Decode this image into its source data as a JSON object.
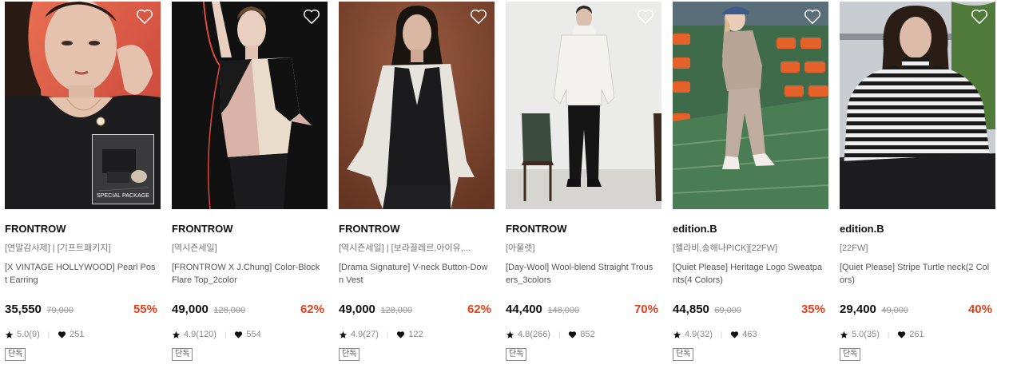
{
  "products": [
    {
      "brand": "FRONTROW",
      "tags": "[연말감사제] | [기프트패키지]",
      "name": "[X VINTAGE HOLLYWOOD] Pearl Post Earring",
      "sale_price": "35,550",
      "original_price": "79,000",
      "discount": "55%",
      "rating": "5.0(9)",
      "likes": "251",
      "badge": "단독",
      "package_label": "SPECIAL PACKAGE",
      "colors": {
        "bg": "#e06548",
        "bg2": "#c8463a",
        "top": "#1d1d1f",
        "skin": "#e4c2ae",
        "hair": "#2a1a14"
      }
    },
    {
      "brand": "FRONTROW",
      "tags": "[역시즌세일]",
      "name": "[FRONTROW X J.Chung] Color-Block Flare Top_2color",
      "sale_price": "49,000",
      "original_price": "128,000",
      "discount": "62%",
      "rating": "4.9(120)",
      "likes": "554",
      "badge": "단독",
      "colors": {
        "bg": "#0f0f10",
        "bg2": "#1a1a1b",
        "top": "#d9b3a7",
        "top2": "#e9dccb",
        "skin": "#e8cfbf",
        "hair": "#6b4a32"
      }
    },
    {
      "brand": "FRONTROW",
      "tags": "[역시즌세일] | [보라끌레르,아이유,...",
      "name": "[Drama Signature] V-neck Button-Down Vest",
      "sale_price": "49,000",
      "original_price": "128,000",
      "discount": "62%",
      "rating": "4.9(27)",
      "likes": "122",
      "badge": "단독",
      "colors": {
        "bg": "#8a4e36",
        "bg2": "#6f3c29",
        "top": "#1b1b1d",
        "shirt": "#e7e3dd",
        "skin": "#d9b7a2",
        "hair": "#1a1410"
      }
    },
    {
      "brand": "FRONTROW",
      "tags": "[아울렛]",
      "name": "[Day-Wool] Wool-blend Straight Trousers_3colors",
      "sale_price": "44,400",
      "original_price": "148,000",
      "discount": "70%",
      "rating": "4.8(266)",
      "likes": "852",
      "badge": "단독",
      "colors": {
        "bg": "#e9e9e7",
        "bg2": "#d4d4d1",
        "top": "#f3f2ee",
        "pants": "#151515",
        "skin": "#dcc0ae",
        "hair": "#2a2420",
        "chair": "#3d2a1f"
      }
    },
    {
      "brand": "edition.B",
      "tags": "[젤라비,송해나PICK][22FW]",
      "name": "[Quiet Please] Heritage Logo Sweatpants(4 Colors)",
      "sale_price": "44,850",
      "original_price": "69,000",
      "discount": "35%",
      "rating": "4.9(32)",
      "likes": "463",
      "badge": "단독",
      "colors": {
        "bg": "#3f6b4b",
        "seat": "#e4622a",
        "top": "#b9a595",
        "skin": "#e8cdb9",
        "hair": "#d7b98d"
      }
    },
    {
      "brand": "edition.B",
      "tags": "[22FW]",
      "name": "[Quiet Please] Stripe Turtle neck(2 Colors)",
      "sale_price": "29,400",
      "original_price": "49,000",
      "discount": "40%",
      "rating": "5.0(35)",
      "likes": "261",
      "badge": "단독",
      "colors": {
        "bg": "#c9cdd2",
        "tree": "#4f7a3a",
        "stripe1": "#1a1a1a",
        "stripe2": "#efefef",
        "skin": "#dcbca9",
        "hair": "#2a1d16"
      }
    }
  ],
  "icons": {
    "wishlist": "heart-outline-icon",
    "rating": "star-icon",
    "likes": "heart-filled-icon"
  }
}
